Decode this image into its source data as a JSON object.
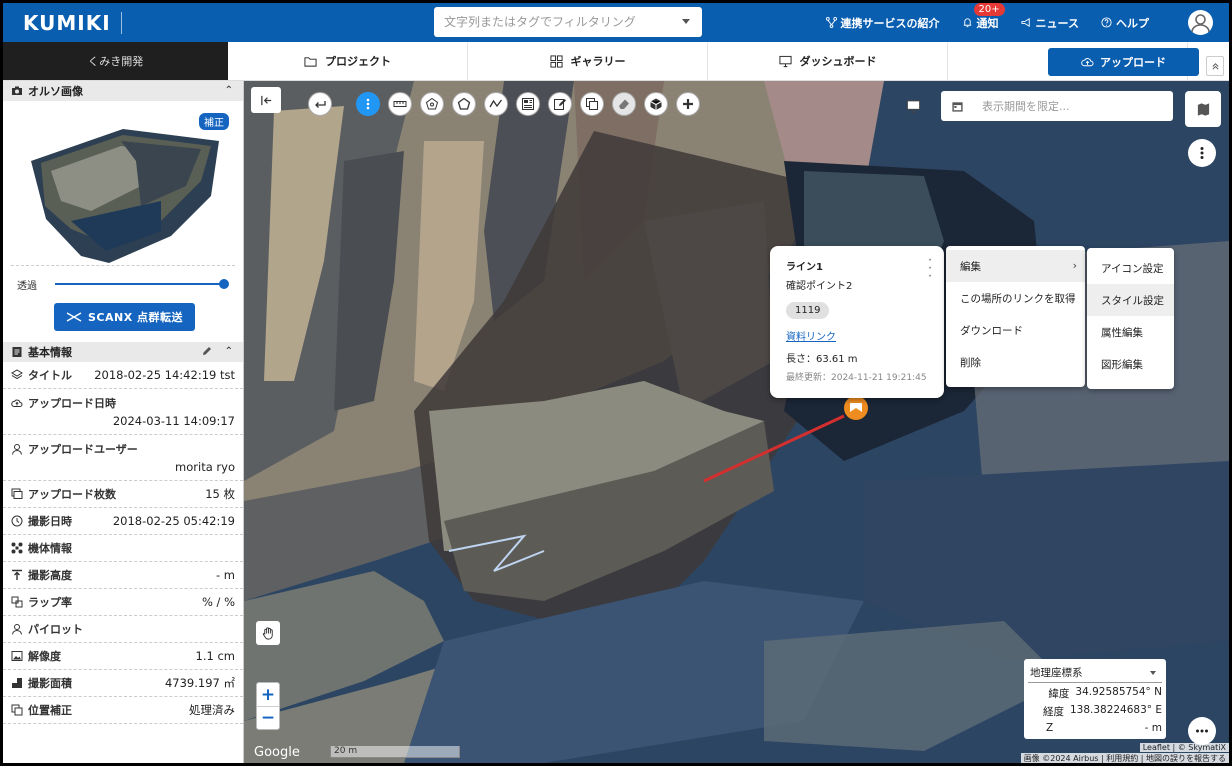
{
  "header": {
    "logo": "KUMIKI",
    "search_placeholder": "文字列またはタグでフィルタリング",
    "links": {
      "services": "連携サービスの紹介",
      "notifications": "通知",
      "notification_badge": "20+",
      "news": "ニュース",
      "help": "ヘルプ"
    }
  },
  "nav": {
    "org": "くみき開発",
    "tabs": [
      "プロジェクト",
      "ギャラリー",
      "ダッシュボード"
    ],
    "upload": "アップロード"
  },
  "sidebar": {
    "ortho_title": "オルソ画像",
    "hosei_badge": "補正",
    "opacity_label": "透過",
    "opacity_value": 1.0,
    "scanx_button": "SCANX 点群転送",
    "basic_title": "基本情報",
    "rows": [
      {
        "label": "タイトル",
        "value": "2018-02-25 14:42:19 tst",
        "icon": "layers-icon"
      },
      {
        "label": "アップロード日時",
        "value": "2024-03-11 14:09:17",
        "icon": "cloud-upload-icon",
        "two": true
      },
      {
        "label": "アップロードユーザー",
        "value": "morita ryo",
        "icon": "user-icon",
        "two": true
      },
      {
        "label": "アップロード枚数",
        "value": "15 枚",
        "icon": "photos-icon"
      },
      {
        "label": "撮影日時",
        "value": "2018-02-25 05:42:19",
        "icon": "clock-icon"
      },
      {
        "label": "機体情報",
        "value": "",
        "icon": "drone-icon"
      },
      {
        "label": "撮影高度",
        "value": "- m",
        "icon": "altitude-icon"
      },
      {
        "label": "ラップ率",
        "value": "% / %",
        "icon": "overlap-icon"
      },
      {
        "label": "パイロット",
        "value": "",
        "icon": "pilot-icon"
      },
      {
        "label": "解像度",
        "value": "1.1 cm",
        "icon": "image-icon"
      },
      {
        "label": "撮影面積",
        "value": "4739.197 ㎡",
        "icon": "area-icon"
      },
      {
        "label": "位置補正",
        "value": "処理済み",
        "icon": "copy-icon"
      }
    ]
  },
  "map": {
    "date_placeholder": "表示期間を限定...",
    "popup": {
      "title": "ライン1",
      "subtitle": "確認ポイント2",
      "chip": "1119",
      "link": "資料リンク",
      "length": "長さ：63.61 m",
      "updated": "最終更新：2024-11-21 19:21:45"
    },
    "menu": [
      "編集",
      "この場所のリンクを取得",
      "ダウンロード",
      "削除"
    ],
    "submenu": [
      "アイコン設定",
      "スタイル設定",
      "属性編集",
      "図形編集"
    ],
    "coord": {
      "system": "地理座標系",
      "lat_label": "緯度",
      "lat": "34.92585754° N",
      "lon_label": "経度",
      "lon": "138.38224683° E",
      "z_label": "Z",
      "z": "- m"
    },
    "google": "Google",
    "scale": "20 m",
    "attrib1": "Leaflet | © SkymatiX",
    "attrib2": "画像 ©2024 Airbus | 利用規約 | 地図の誤りを報告する",
    "zoom_in": "+",
    "zoom_out": "−"
  }
}
